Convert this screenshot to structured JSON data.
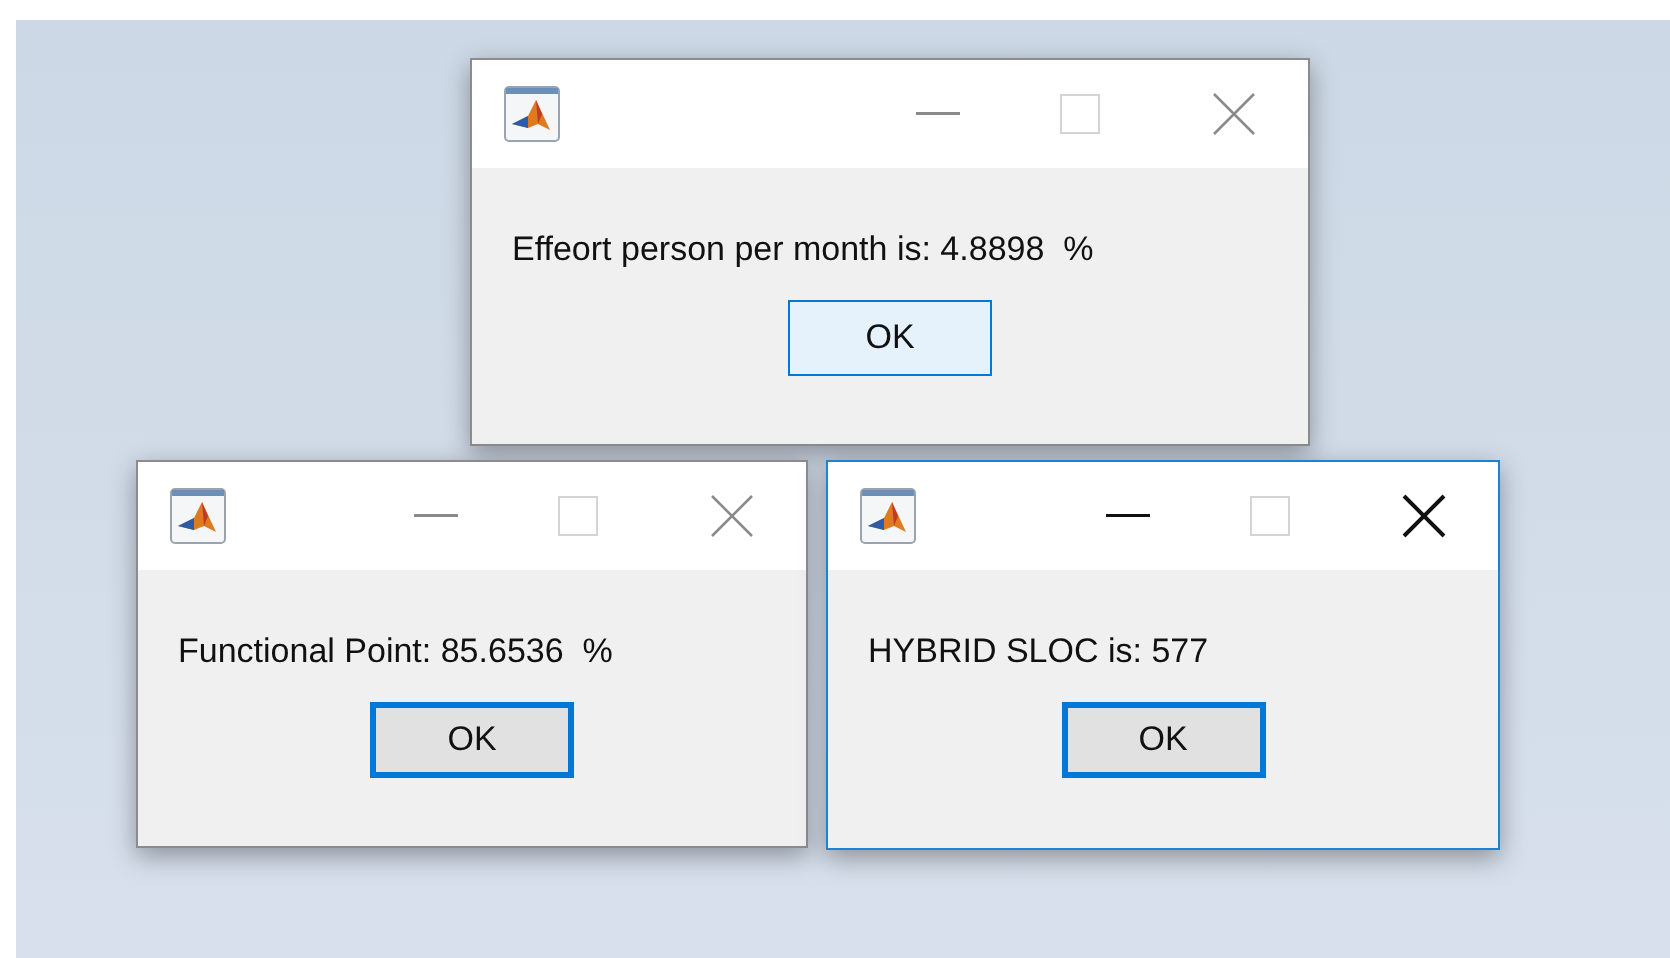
{
  "dialogs": [
    {
      "message": "Effeort person per month is: 4.8898  %",
      "active": false,
      "button": {
        "label": "OK",
        "kind": "hovered"
      }
    },
    {
      "message": "Functional Point: 85.6536  %",
      "active": false,
      "button": {
        "label": "OK",
        "kind": "focused"
      }
    },
    {
      "message": "HYBRID SLOC is: 577",
      "active": true,
      "button": {
        "label": "OK",
        "kind": "focused"
      }
    }
  ]
}
